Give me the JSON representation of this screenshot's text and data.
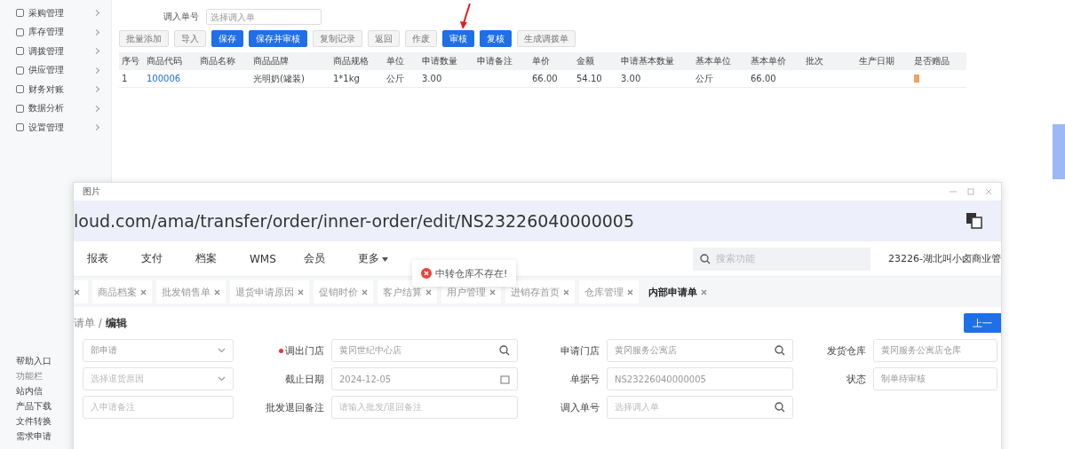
{
  "sidebar": {
    "items": [
      {
        "label": "采购管理"
      },
      {
        "label": "库存管理"
      },
      {
        "label": "调拨管理"
      },
      {
        "label": "供应管理"
      },
      {
        "label": "财务对账"
      },
      {
        "label": "数据分析"
      },
      {
        "label": "设置管理"
      }
    ],
    "bottom_items": [
      {
        "label": "帮助入口"
      },
      {
        "label": "功能栏",
        "kind": "heading"
      },
      {
        "label": "站内信"
      },
      {
        "label": "产品下载"
      },
      {
        "label": "文件转换"
      },
      {
        "label": "需求申请"
      }
    ]
  },
  "inbound_search": {
    "label": "调入单号",
    "placeholder": "选择调入单"
  },
  "toolbar": [
    {
      "label": "批量添加",
      "primary": false
    },
    {
      "label": "导入",
      "primary": false
    },
    {
      "label": "保存",
      "primary": true
    },
    {
      "label": "保存并审核",
      "primary": true
    },
    {
      "label": "复制记录",
      "primary": false
    },
    {
      "label": "返回",
      "primary": false
    },
    {
      "label": "作废",
      "primary": false
    },
    {
      "label": "审核",
      "primary": true,
      "pointed": true
    },
    {
      "label": "复核",
      "primary": true
    },
    {
      "label": "生成调拨单",
      "primary": false
    }
  ],
  "table": {
    "columns": [
      "序号",
      "商品代码",
      "商品名称",
      "商品品牌",
      "商品规格",
      "单位",
      "申请数量",
      "申请备注",
      "单价",
      "金额",
      "申请基本数量",
      "基本单位",
      "基本单价",
      "批次",
      "生产日期",
      "是否赠品"
    ],
    "rows": [
      {
        "cells": [
          "1",
          "100006",
          "",
          "光明奶(罐装)",
          "1*1kg",
          "公斤",
          "3.00",
          "",
          "66.00",
          "54.10",
          "3.00",
          "公斤",
          "66.00",
          "",
          "",
          ""
        ],
        "gift": false
      }
    ]
  },
  "popup": {
    "title": "图片",
    "url": "loud.com/ama/transfer/order/inner-order/edit/NS23226040000005",
    "nav": [
      "报表",
      "支付",
      "档案",
      "WMS",
      "会员",
      "更多"
    ],
    "search": {
      "placeholder": "搜索功能"
    },
    "more_menu": true,
    "company": "23226-湖北叫小卤商业管",
    "toast": {
      "message": "中转仓库不存在!"
    },
    "tabs": [
      {
        "label": "商品档案",
        "selected": false
      },
      {
        "label": "批发销售单",
        "selected": false
      },
      {
        "label": "退货申请原因",
        "selected": false
      },
      {
        "label": "促销时价",
        "selected": false
      },
      {
        "label": "客户结算",
        "selected": false
      },
      {
        "label": "用户管理",
        "selected": false
      },
      {
        "label": "进销存首页",
        "selected": false
      },
      {
        "label": "仓库管理",
        "selected": false
      },
      {
        "label": "内部申请单",
        "selected": true
      }
    ],
    "breadcrumb": {
      "parent": "请单",
      "separator": "/",
      "current": "编辑"
    },
    "prev_button": "上一",
    "form": [
      [
        {
          "kind": "select",
          "value": "部申请"
        },
        {
          "kind": "search",
          "label": "调出门店",
          "required": true,
          "value": "黄冈世纪中心店"
        },
        {
          "kind": "search",
          "label": "申请门店",
          "value": "黄冈服务公寓店"
        },
        {
          "kind": "text",
          "label": "发货仓库",
          "value": "黄冈服务公寓店仓库"
        }
      ],
      [
        {
          "kind": "select",
          "placeholder": "选择退货原因"
        },
        {
          "kind": "date",
          "label": "截止日期",
          "value": "2024-12-05"
        },
        {
          "kind": "text",
          "label": "单据号",
          "value": "NS23226040000005"
        },
        {
          "kind": "text",
          "label": "状态",
          "value": "制单待审核"
        }
      ],
      [
        {
          "kind": "text",
          "placeholder": "入申请备注"
        },
        {
          "kind": "text",
          "label": "批发退回备注",
          "placeholder": "请输入批发/退回备注"
        },
        {
          "kind": "search",
          "label": "调入单号",
          "placeholder": "选择调入单"
        }
      ]
    ]
  }
}
